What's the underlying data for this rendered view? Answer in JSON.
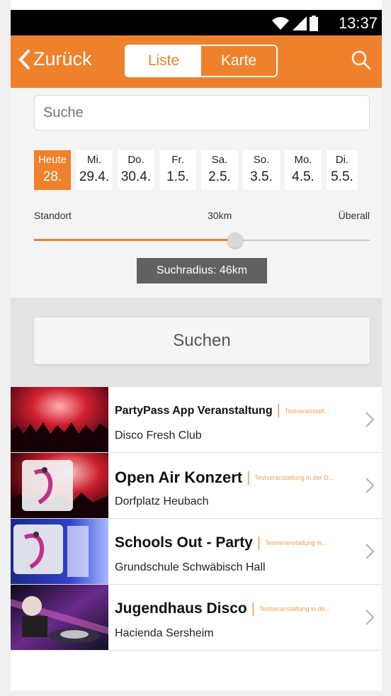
{
  "status": {
    "time": "13:37"
  },
  "nav": {
    "back_label": "Zurück",
    "tab_list": "Liste",
    "tab_map": "Karte"
  },
  "search": {
    "placeholder": "Suche"
  },
  "days": [
    {
      "name": "Heute",
      "date": "28.",
      "active": true
    },
    {
      "name": "Mi.",
      "date": "29.4.",
      "active": false
    },
    {
      "name": "Do.",
      "date": "30.4.",
      "active": false
    },
    {
      "name": "Fr.",
      "date": "1.5.",
      "active": false
    },
    {
      "name": "Sa.",
      "date": "2.5.",
      "active": false
    },
    {
      "name": "So.",
      "date": "3.5.",
      "active": false
    },
    {
      "name": "Mo.",
      "date": "4.5.",
      "active": false
    },
    {
      "name": "Di.",
      "date": "5.5.",
      "active": false
    }
  ],
  "radius": {
    "left_label": "Standort",
    "mid_label": "30km",
    "right_label": "Überall",
    "tooltip": "Suchradius: 46km",
    "fraction": 0.6
  },
  "search_button": "Suchen",
  "events": [
    {
      "title": "PartyPass App Veranstaltung",
      "subtitle": "Testveranstalt...",
      "location": "Disco Fresh Club",
      "image": "concert-crowd-image"
    },
    {
      "title": "Open Air Konzert",
      "subtitle": "Testveranstaltung in der D...",
      "location": "Dorfplatz Heubach",
      "image": "concert-logo-image"
    },
    {
      "title": "Schools Out - Party",
      "subtitle": "Testveranstaltung in...",
      "location": "Grundschule Schwäbisch Hall",
      "image": "stage-logo-image"
    },
    {
      "title": "Jugendhaus Disco",
      "subtitle": "Testveranstaltung in de...",
      "location": "Hacienda Sersheim",
      "image": "dj-image"
    }
  ],
  "colors": {
    "accent": "#f0812c",
    "tooltip": "#616161",
    "separator": "#f0a050"
  }
}
